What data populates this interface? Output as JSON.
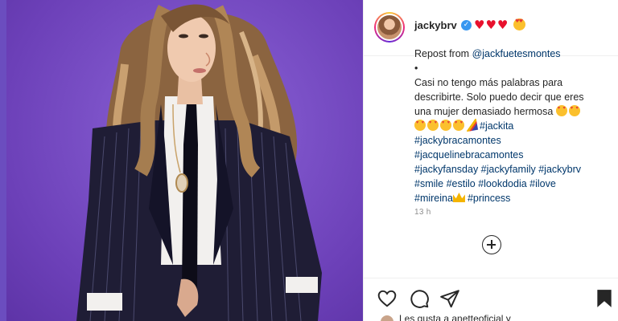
{
  "post": {
    "username": "jackybrv",
    "verified_mark": "✓",
    "header_emojis": [
      "heart-emoji",
      "heart-emoji",
      "heart-emoji",
      "heart-eyes-emoji"
    ],
    "caption": {
      "repost_prefix": "Repost from ",
      "repost_user": "@jackfuetesmontes",
      "bullet": "•",
      "text_line1": "Casi no tengo más palabras para",
      "text_line2": "describirte. Solo puedo decir que eres",
      "text_line3": "una mujer demasiado hermosa",
      "tags_line4": "#jackita",
      "tags_line5": "#jackybracamontes",
      "tags_line6": "#jacquelinebracamontes",
      "tags_line7": "#jackyfansday #jackyfamily #jackybrv",
      "tags_line8": "#smile #estilo #lookdodia #ilove",
      "tags_line9a": "#mireina",
      "tags_line9b": "#princess"
    },
    "timestamp": "13 h",
    "likes_text": "Les gusta a anetteoficial y"
  },
  "colors": {
    "background_purple": "#7c52c8",
    "link_blue": "#00376b",
    "verified_blue": "#3897f0",
    "heart_red": "#e8112d"
  },
  "icons": {
    "like": "heart-outline-icon",
    "comment": "comment-bubble-icon",
    "share": "paper-plane-icon",
    "save": "bookmark-icon",
    "add_comment": "plus-circle-icon"
  }
}
